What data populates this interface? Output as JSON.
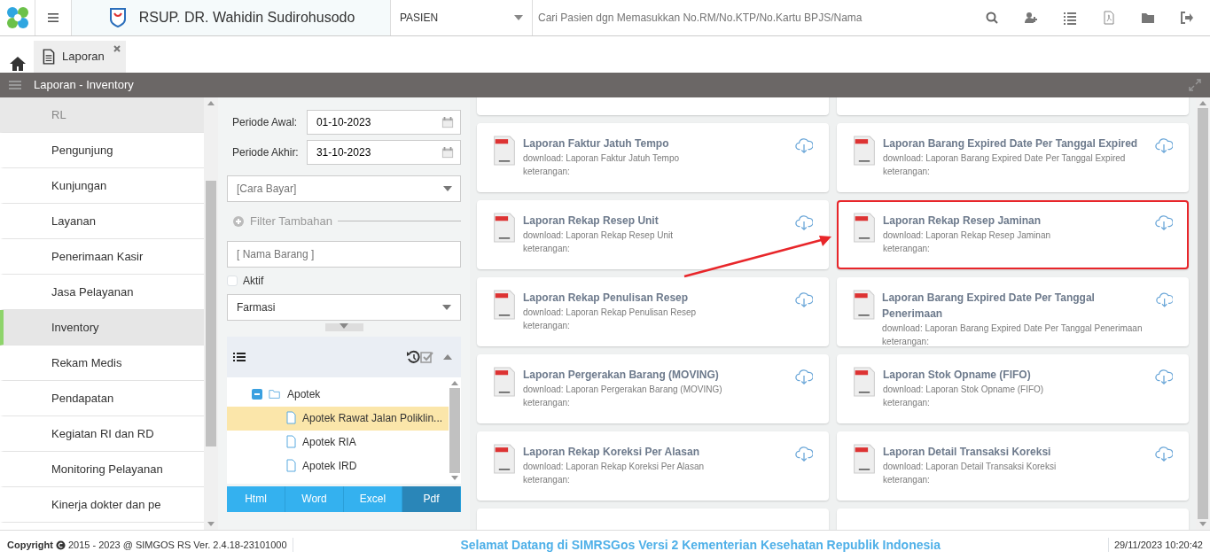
{
  "header": {
    "hospital": "RSUP. DR. Wahidin Sudirohusodo",
    "search_type": "PASIEN",
    "search": {
      "placeholder": "Cari Pasien dgn Memasukkan No.RM/No.KTP/No.Kartu BPJS/Nama"
    }
  },
  "tabs": [
    {
      "label": "Laporan",
      "selected": true
    }
  ],
  "panel_title": "Laporan - Inventory",
  "sidebar": {
    "items": [
      {
        "label": "RL",
        "selected": false,
        "disabled": true
      },
      {
        "label": "Pengunjung",
        "selected": false,
        "disabled": false
      },
      {
        "label": "Kunjungan",
        "selected": false,
        "disabled": false
      },
      {
        "label": "Layanan",
        "selected": false,
        "disabled": false
      },
      {
        "label": "Penerimaan Kasir",
        "selected": false,
        "disabled": false
      },
      {
        "label": "Jasa Pelayanan",
        "selected": false,
        "disabled": false
      },
      {
        "label": "Inventory",
        "selected": true,
        "disabled": false
      },
      {
        "label": "Rekam Medis",
        "selected": false,
        "disabled": false
      },
      {
        "label": "Pendapatan",
        "selected": false,
        "disabled": false
      },
      {
        "label": "Kegiatan RI dan RD",
        "selected": false,
        "disabled": false
      },
      {
        "label": "Monitoring Pelayanan",
        "selected": false,
        "disabled": false
      },
      {
        "label": "Kinerja dokter dan pe",
        "selected": false,
        "disabled": false
      }
    ]
  },
  "filters": {
    "periode_awal": {
      "label": "Periode Awal:",
      "value": "01-10-2023"
    },
    "periode_akhir": {
      "label": "Periode Akhir:",
      "value": "31-10-2023"
    },
    "cara_bayar": {
      "placeholder": "[Cara Bayar]"
    },
    "filter_tambahan": "Filter Tambahan",
    "nama_barang": {
      "placeholder": "[ Nama Barang ]"
    },
    "aktif": {
      "label": "Aktif",
      "checked": false
    },
    "jenis": {
      "value": "Farmasi"
    }
  },
  "tree": [
    {
      "label": "Apotek",
      "expanded": true,
      "selected": false,
      "children": [
        {
          "label": "Apotek Rawat Jalan Poliklin...",
          "selected": true
        },
        {
          "label": "Apotek RIA",
          "selected": false
        },
        {
          "label": "Apotek IRD",
          "selected": false
        }
      ]
    }
  ],
  "export_buttons": [
    {
      "label": "Html",
      "selected": false
    },
    {
      "label": "Word",
      "selected": false
    },
    {
      "label": "Excel",
      "selected": false
    },
    {
      "label": "Pdf",
      "selected": true
    }
  ],
  "reports": [
    {
      "title": "Laporan Faktur Jatuh Tempo",
      "download": "download: Laporan Faktur Jatuh Tempo",
      "note": "keterangan:",
      "highlighted": false
    },
    {
      "title": "Laporan Barang Expired Date Per Tanggal Expired",
      "download": "download: Laporan Barang Expired Date Per Tanggal Expired",
      "note": "keterangan:",
      "highlighted": false
    },
    {
      "title": "Laporan Rekap Resep Unit",
      "download": "download: Laporan Rekap Resep Unit",
      "note": "keterangan:",
      "highlighted": false
    },
    {
      "title": "Laporan Rekap Resep Jaminan",
      "download": "download: Laporan Rekap Resep Jaminan",
      "note": "keterangan:",
      "highlighted": true
    },
    {
      "title": "Laporan Rekap Penulisan Resep",
      "download": "download: Laporan Rekap Penulisan Resep",
      "note": "keterangan:",
      "highlighted": false
    },
    {
      "title": "Laporan Barang Expired Date Per Tanggal Penerimaan",
      "download": "download: Laporan Barang Expired Date Per Tanggal Penerimaan",
      "note": "keterangan:",
      "highlighted": false
    },
    {
      "title": "Laporan Pergerakan Barang (MOVING)",
      "download": "download: Laporan Pergerakan Barang (MOVING)",
      "note": "keterangan:",
      "highlighted": false
    },
    {
      "title": "Laporan Stok Opname (FIFO)",
      "download": "download: Laporan Stok Opname (FIFO)",
      "note": "keterangan:",
      "highlighted": false
    },
    {
      "title": "Laporan Rekap Koreksi Per Alasan",
      "download": "download: Laporan Rekap Koreksi Per Alasan",
      "note": "keterangan:",
      "highlighted": false
    },
    {
      "title": "Laporan Detail Transaksi Koreksi",
      "download": "download: Laporan Detail Transaksi Koreksi",
      "note": "keterangan:",
      "highlighted": false
    }
  ],
  "status_bar": {
    "copyright": "Copyright",
    "version": "2015 - 2023 @ SIMGOS RS Ver. 2.4.18-23101000",
    "welcome": "Selamat Datang di SIMRSGos Versi 2 Kementerian Kesehatan Republik Indonesia",
    "datetime": "29/11/2023 10:20:42"
  }
}
